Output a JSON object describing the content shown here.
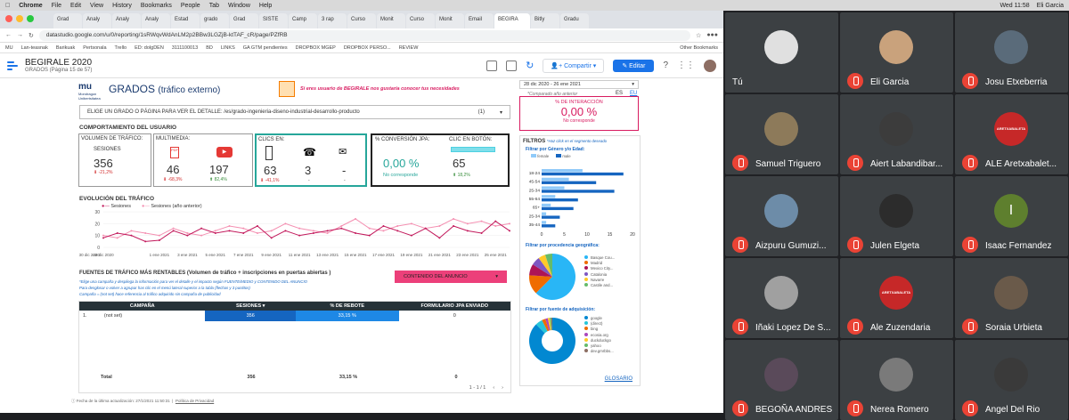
{
  "macos": {
    "menu": [
      "Chrome",
      "File",
      "Edit",
      "View",
      "History",
      "Bookmarks",
      "People",
      "Tab",
      "Window",
      "Help"
    ],
    "clock": "Wed 11:58",
    "user": "Eli Garcia"
  },
  "browser": {
    "tabs": [
      "Grad",
      "Analy",
      "Analy",
      "Analy",
      "Estad",
      "grado",
      "Grad",
      "SISTE",
      "Camp",
      "3 rap",
      "Curso",
      "Monit",
      "Curso",
      "Monit",
      "Email",
      "BEGIRA",
      "Bitly",
      "Gradu"
    ],
    "url": "datastudio.google.com/u/0/reporting/1sRWqvWdAnLM2p2BBw3LGZjB-ktTAF_cR/page/PZfRB",
    "bookmarks": [
      "MU",
      "Lan-teasnak",
      "Barikuak",
      "Pertsonala",
      "Trello",
      "ED: dolgDEN",
      "3111100013",
      "BD",
      "LINKS",
      "GA GTM pendientes",
      "DROPBOX MGEP",
      "DROPBOX PERSO...",
      "REVIEW",
      "Other Bookmarks"
    ]
  },
  "datastudio": {
    "title": "BEGIRALE 2020",
    "subtitle": "GRADOS (Página 15 de 57)",
    "share_label": "Compartir",
    "edit_label": "Editar"
  },
  "report": {
    "brand": "Mondragon Unibertsitatea",
    "title": "GRADOS",
    "title_suffix": "(tráfico externo)",
    "banner": "Si eres usuario de BEGIRALE nos gustaría conocer tus necesidades",
    "date_range": "28 dic 2020 - 26 ene 2021",
    "compare_label": "*Comparado año anterior",
    "lang_es": "ES",
    "lang_eu": "EU",
    "filter_label": "ELIGE UN GRADO O PÁGINA PARA VER EL DETALLE",
    "filter_value": "/es/grado-ingenieria-diseno-industrial-desarrollo-producto",
    "filter_count": "(1)",
    "interaction_label": "% DE INTERACCIÓN",
    "interaction_value": "0,00 %",
    "interaction_note": "No corresponde",
    "behavior_title": "COMPORTAMIENTO DEL USUARIO",
    "volume_title": "VOLUMEN DE TRÁFICO:",
    "sessions_label": "SESIONES",
    "sessions_value": "356",
    "sessions_delta": "-21,2%",
    "multimedia_title": "MULTIMEDIA:",
    "pdf_value": "46",
    "pdf_delta": "-68,3%",
    "youtube_value": "197",
    "youtube_delta": "82,4%",
    "clicks_title": "CLICS EN:",
    "door_value": "63",
    "door_delta": "-41,1%",
    "phone_value": "3",
    "phone_delta": "-",
    "mail_value": "-",
    "mail_delta": "-",
    "conv_label": "% CONVERSIÓN JPA:",
    "conv_value": "0,00 %",
    "conv_note": "No corresponde",
    "btn_label": "CLIC EN BOTÓN:",
    "btn_value": "65",
    "btn_delta": "18,2%",
    "evolution_title": "EVOLUCIÓN DEL TRÁFICO",
    "legend_current": "Sesiones",
    "legend_previous": "Sesiones (año anterior)",
    "sources_title": "FUENTES DE TRÁFICO MÁS RENTABLES  (Volumen de tráfico + inscripciones en puertas abiertas )",
    "sources_note1": "*Elige una campaña y despliega la información para ver el detalle y el impacto según FUENTE/MEDIO y CONTENIDO DEL ANUNCIO",
    "sources_note2": "Para desglosar o volver a agrupar has clic en el menú lateral superior a la tabla (flechas y 3 puntitos)",
    "sources_note3": "Campaña = (not set) hace referencia al tráfico adquirido sin campaña de publicidad",
    "ad_content_label": "CONTENIDO DEL ANUNCIO",
    "table": {
      "headers": [
        "CAMPAÑA",
        "SESIONES ▾",
        "% DE REBOTE",
        "FORMULARIO JPA ENVIADO"
      ],
      "rows": [
        [
          "1.",
          "(not set)",
          "356",
          "33,15 %",
          "0"
        ]
      ],
      "total": [
        "Total",
        "356",
        "33,15 %",
        "0"
      ],
      "pager": "1 - 1 / 1"
    },
    "filters_title": "FILTROS",
    "filters_hint": "*Haz click en el segmento deseado",
    "gender_title": "Filtrar por Género y/o Edad:",
    "gender_legend": [
      "female",
      "male"
    ],
    "age_labels": [
      "18-24",
      "45-54",
      "25-34",
      "55-64",
      "65+",
      "25-34",
      "35-44"
    ],
    "geo_title": "Filtrar por procedencia geográfica:",
    "geo_legend": [
      "Basque Cou...",
      "Madrid",
      "Mexico City...",
      "Catalonia",
      "Navarre",
      "Castile and..."
    ],
    "acq_title": "Filtrar por fuente de adquisición:",
    "acq_legend": [
      "google",
      "(direct)",
      "bing",
      "ecosia.org",
      "duckduckgo",
      "yahoo",
      "dev.gmrbbs..."
    ],
    "glossary": "GLOSARIO",
    "footer": "Fecha de la última actualización: 27/1/2021 11:50:31",
    "privacy": "Política de Privacidad"
  },
  "chart_data": [
    {
      "type": "line",
      "title": "EVOLUCIÓN DEL TRÁFICO",
      "x": [
        "28 dic 2020",
        "29 dic",
        "30 dic",
        "31 dic",
        "1 ene 2021",
        "2 ene",
        "3 ene 2021",
        "4 ene",
        "5 ene 2021",
        "6 ene",
        "7 ene 2021",
        "8 ene",
        "9 ene 2021",
        "10 ene",
        "11 ene 2021",
        "12 ene",
        "13 ene 2021",
        "14 ene",
        "15 ene 2021",
        "16 ene",
        "17 ene 2021",
        "18 ene",
        "19 ene 2021",
        "20 ene",
        "21 ene 2021",
        "22 ene",
        "23 ene 2021",
        "24 ene",
        "25 ene 2021",
        "26 ene"
      ],
      "x_ticks": [
        "28 dic 2020",
        "30 dic 2020",
        "1 ene 2021",
        "3 ene 2021",
        "5 ene 2021",
        "7 ene 2021",
        "9 ene 2021",
        "11 ene 2021",
        "13 ene 2021",
        "15 ene 2021",
        "17 ene 2021",
        "19 ene 2021",
        "21 ene 2021",
        "23 ene 2021",
        "25 ene 2021"
      ],
      "ylim": [
        0,
        30
      ],
      "y_ticks": [
        0,
        10,
        20,
        30
      ],
      "series": [
        {
          "name": "Sesiones",
          "color": "#c2185b",
          "values": [
            8,
            12,
            10,
            5,
            6,
            14,
            10,
            16,
            12,
            14,
            12,
            18,
            8,
            14,
            10,
            12,
            14,
            16,
            12,
            10,
            18,
            14,
            10,
            16,
            8,
            18,
            14,
            12,
            22,
            14
          ]
        },
        {
          "name": "Sesiones (año anterior)",
          "color": "#f48fb1",
          "values": [
            10,
            8,
            14,
            12,
            10,
            16,
            12,
            10,
            14,
            18,
            16,
            12,
            14,
            20,
            16,
            14,
            12,
            18,
            24,
            16,
            14,
            18,
            20,
            16,
            18,
            24,
            20,
            22,
            18,
            20
          ]
        }
      ]
    },
    {
      "type": "bar",
      "title": "Filtrar por Género y/o Edad:",
      "categories": [
        "18-24",
        "45-54",
        "25-34",
        "55-64",
        "65+",
        "25-34",
        "35-44"
      ],
      "xlim": [
        0,
        20
      ],
      "x_ticks": [
        0,
        5,
        10,
        15,
        20
      ],
      "series": [
        {
          "name": "female",
          "color": "#90caf9",
          "values": [
            9,
            6,
            5,
            3,
            2,
            1,
            1
          ]
        },
        {
          "name": "male",
          "color": "#1565c0",
          "values": [
            18,
            12,
            16,
            8,
            7,
            4,
            3
          ]
        }
      ]
    },
    {
      "type": "pie",
      "title": "Filtrar por procedencia geográfica:",
      "categories": [
        "Basque Cou...",
        "Madrid",
        "Mexico City...",
        "Catalonia",
        "Navarre",
        "Castile and..."
      ],
      "values": [
        62.5,
        13.5,
        8,
        6,
        5,
        5
      ],
      "colors": [
        "#29b6f6",
        "#ef6c00",
        "#ad1457",
        "#7e57c2",
        "#ffca28",
        "#66bb6a"
      ]
    },
    {
      "type": "pie",
      "title": "Filtrar por fuente de adquisición:",
      "categories": [
        "google",
        "(direct)",
        "bing",
        "ecosia.org",
        "duckduckgo",
        "yahoo",
        "dev.gmrbbs..."
      ],
      "values": [
        87.6,
        5,
        2.5,
        1.8,
        1.3,
        1,
        0.8
      ],
      "colors": [
        "#0288d1",
        "#26c6da",
        "#ef6c00",
        "#ab47bc",
        "#ffca28",
        "#66bb6a",
        "#8d6e63"
      ]
    }
  ],
  "meet": {
    "participants": [
      {
        "name": "Tú",
        "color": "#e0e0e0"
      },
      {
        "name": "Eli Garcia",
        "color": "#c9a27c"
      },
      {
        "name": "Josu Etxeberria",
        "color": "#5a6b7a"
      },
      {
        "name": "Samuel Triguero",
        "color": "#8d7a5a"
      },
      {
        "name": "Aiert Labandibar...",
        "color": "#3c3c3c"
      },
      {
        "name": "ALE Aretxabalet...",
        "color": "#c62828"
      },
      {
        "name": "Aizpuru Gumuzi...",
        "color": "#6d8ca8"
      },
      {
        "name": "Julen Elgeta",
        "color": "#2c2c2c"
      },
      {
        "name": "Isaac Fernandez",
        "color": "#5e7f2e"
      },
      {
        "name": "Iñaki Lopez De S...",
        "color": "#a0a0a0"
      },
      {
        "name": "Ale Zuzendaria",
        "color": "#c62828"
      },
      {
        "name": "Soraia Urbieta",
        "color": "#6a5a4a"
      },
      {
        "name": "BEGOÑA ANDRES",
        "color": "#5a4a5a"
      },
      {
        "name": "Nerea Romero",
        "color": "#7a7a7a"
      },
      {
        "name": "Angel Del Rio",
        "color": "#3a3a3a"
      }
    ],
    "isaac_initial": "I",
    "aretxabaleta_logo": "ARETXABALETA"
  }
}
